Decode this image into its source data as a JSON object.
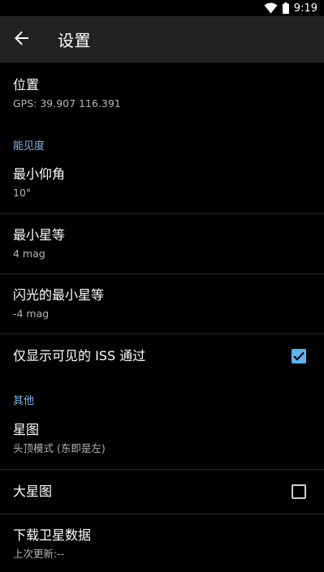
{
  "status_bar": {
    "time": "9:19"
  },
  "app_bar": {
    "title": "设置"
  },
  "location": {
    "title": "位置",
    "summary": "GPS: 39.907 116.391"
  },
  "visibility": {
    "header": "能见度",
    "min_elevation": {
      "title": "最小仰角",
      "summary": "10°"
    },
    "min_magnitude": {
      "title": "最小星等",
      "summary": "4 mag"
    },
    "min_flare_magnitude": {
      "title": "闪光的最小星等",
      "summary": "-4 mag"
    },
    "visible_iss_only": {
      "title": "仅显示可见的 ISS 通过",
      "checked": true
    }
  },
  "other": {
    "header": "其他",
    "star_map": {
      "title": "星图",
      "summary": "头顶模式 (东即是左)"
    },
    "large_star_map": {
      "title": "大星图",
      "checked": false
    },
    "download_satellite_data": {
      "title": "下载卫星数据",
      "summary": "上次更新:--"
    }
  }
}
